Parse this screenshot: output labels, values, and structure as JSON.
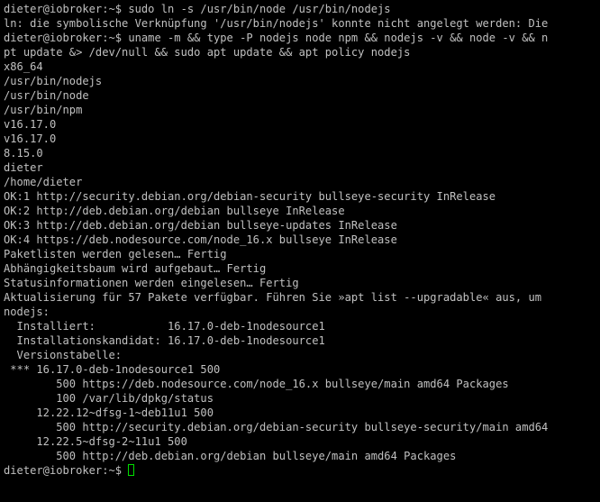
{
  "colors": {
    "background": "#000000",
    "foreground": "#c0c0c0",
    "cursor": "#00e000"
  },
  "terminal": {
    "lines": [
      "dieter@iobroker:~$ sudo ln -s /usr/bin/node /usr/bin/nodejs",
      "ln: die symbolische Verknüpfung '/usr/bin/nodejs' konnte nicht angelegt werden: Die",
      "dieter@iobroker:~$ uname -m && type -P nodejs node npm && nodejs -v && node -v && n",
      "pt update &> /dev/null && sudo apt update && apt policy nodejs",
      "x86_64",
      "/usr/bin/nodejs",
      "/usr/bin/node",
      "/usr/bin/npm",
      "v16.17.0",
      "v16.17.0",
      "8.15.0",
      "dieter",
      "/home/dieter",
      "OK:1 http://security.debian.org/debian-security bullseye-security InRelease",
      "OK:2 http://deb.debian.org/debian bullseye InRelease",
      "OK:3 http://deb.debian.org/debian bullseye-updates InRelease",
      "OK:4 https://deb.nodesource.com/node_16.x bullseye InRelease",
      "Paketlisten werden gelesen… Fertig",
      "Abhängigkeitsbaum wird aufgebaut… Fertig",
      "Statusinformationen werden eingelesen… Fertig",
      "Aktualisierung für 57 Pakete verfügbar. Führen Sie »apt list --upgradable« aus, um",
      "nodejs:",
      "  Installiert:           16.17.0-deb-1nodesource1",
      "  Installationskandidat: 16.17.0-deb-1nodesource1",
      "  Versionstabelle:",
      " *** 16.17.0-deb-1nodesource1 500",
      "        500 https://deb.nodesource.com/node_16.x bullseye/main amd64 Packages",
      "        100 /var/lib/dpkg/status",
      "     12.22.12~dfsg-1~deb11u1 500",
      "        500 http://security.debian.org/debian-security bullseye-security/main amd64",
      "     12.22.5~dfsg-2~11u1 500",
      "        500 http://deb.debian.org/debian bullseye/main amd64 Packages"
    ],
    "prompt": "dieter@iobroker:~$ "
  }
}
